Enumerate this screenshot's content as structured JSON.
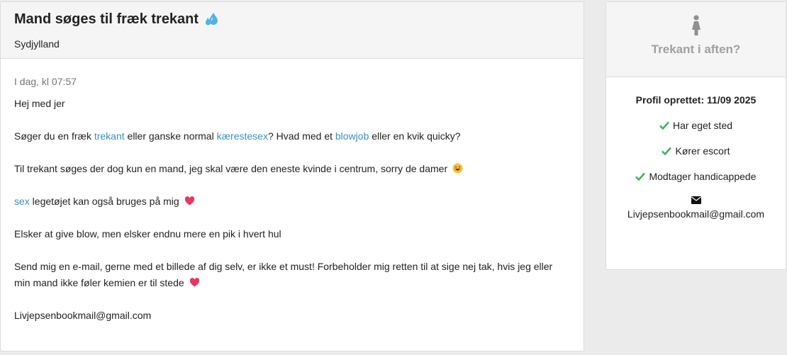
{
  "post": {
    "title": "Mand søges til fræk trekant",
    "region": "Sydjylland",
    "date": "I dag, kl 07:57",
    "greeting": "Hej med jer",
    "p2": {
      "a": "Søger du en fræk ",
      "link1": "trekant",
      "b": " eller ganske normal ",
      "link2": "kærestesex",
      "c": "? Hvad med et ",
      "link3": "blowjob",
      "d": " eller en kvik quicky?"
    },
    "p3": "Til trekant søges der dog kun en mand, jeg skal være den eneste kvinde i centrum, sorry de damer",
    "p4": {
      "link": "sex",
      "text": " legetøjet kan også bruges på mig"
    },
    "p5": "Elsker at give blow, men elsker endnu mere en pik i hvert hul",
    "p6": "Send mig en e-mail, gerne med et billede af dig selv, er ikke et must! Forbeholder mig retten til at sige nej tak, hvis jeg eller min mand ikke føler kemien er til stede",
    "email": "Livjepsenbookmail@gmail.com"
  },
  "sidebar": {
    "title": "Trekant i aften?",
    "profile_created": "Profil oprettet: 11/09 2025",
    "features": [
      "Har eget sted",
      "Kører escort",
      "Modtager handicappede"
    ],
    "email": "Livjepsenbookmail@gmail.com"
  },
  "colors": {
    "link": "#3a90c0",
    "check": "#3cb45a",
    "heart": "#e8365d"
  },
  "icons": [
    "water-drops-icon",
    "grinning-face-icon",
    "heart-icon",
    "woman-icon",
    "check-icon",
    "envelope-icon"
  ]
}
